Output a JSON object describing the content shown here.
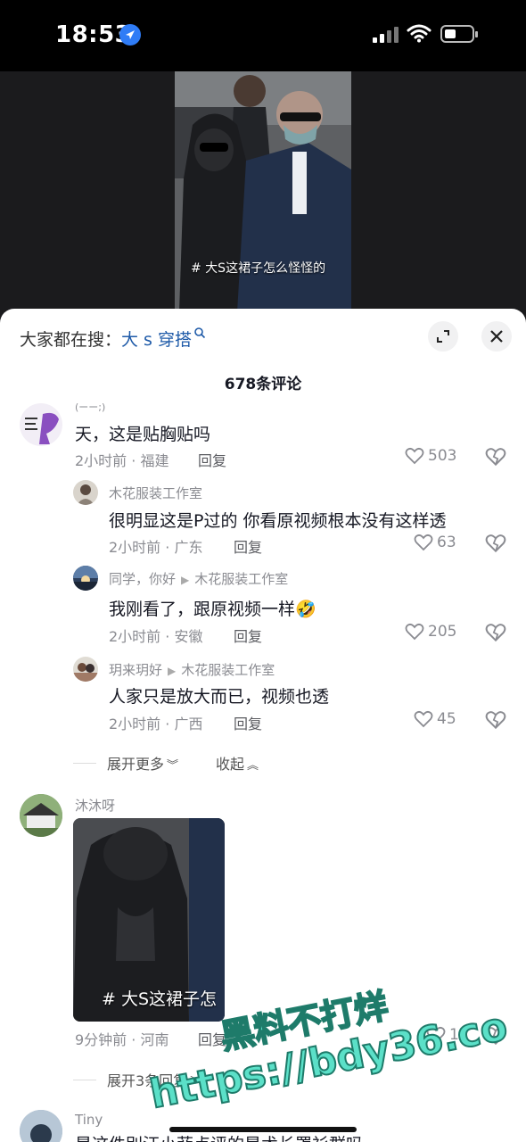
{
  "status_bar": {
    "time": "18:53"
  },
  "video": {
    "caption": "# 大S这裙子怎么怪怪的"
  },
  "sheet": {
    "search_prefix": "大家都在搜：",
    "search_term": "大 s 穿搭",
    "comment_count": "678条评论"
  },
  "comments": [
    {
      "user": "(ーー;)",
      "text": "天，这是贴胸贴吗",
      "time": "2小时前 · 福建",
      "reply": "回复",
      "likes": "503"
    },
    {
      "user": "木花服装工作室",
      "text": "很明显这是P过的 你看原视频根本没有这样透",
      "time": "2小时前 · 广东",
      "reply": "回复",
      "likes": "63"
    },
    {
      "user": "同学，你好",
      "reply_to": "木花服装工作室",
      "text": "我刚看了，跟原视频一样🤣",
      "time": "2小时前 · 安徽",
      "reply": "回复",
      "likes": "205"
    },
    {
      "user": "玥来玥好",
      "reply_to": "木花服装工作室",
      "text": "人家只是放大而已，视频也透",
      "time": "2小时前 · 广西",
      "reply": "回复",
      "likes": "45"
    }
  ],
  "thread_controls": {
    "expand_more": "展开更多",
    "collapse": "收起"
  },
  "comment2": {
    "user": "沐沐呀",
    "image_caption": "# 大S这裙子怎",
    "time": "9分钟前 · 河南",
    "reply": "回复",
    "likes": "1",
    "expand_replies": "展开3条回复"
  },
  "comment3": {
    "user": "Tiny",
    "text": "是这件別汪小菲点评的是术长罩衫群吗"
  },
  "watermark": {
    "line1": "黑料不打烊",
    "line2": "https://bdy36.co"
  }
}
